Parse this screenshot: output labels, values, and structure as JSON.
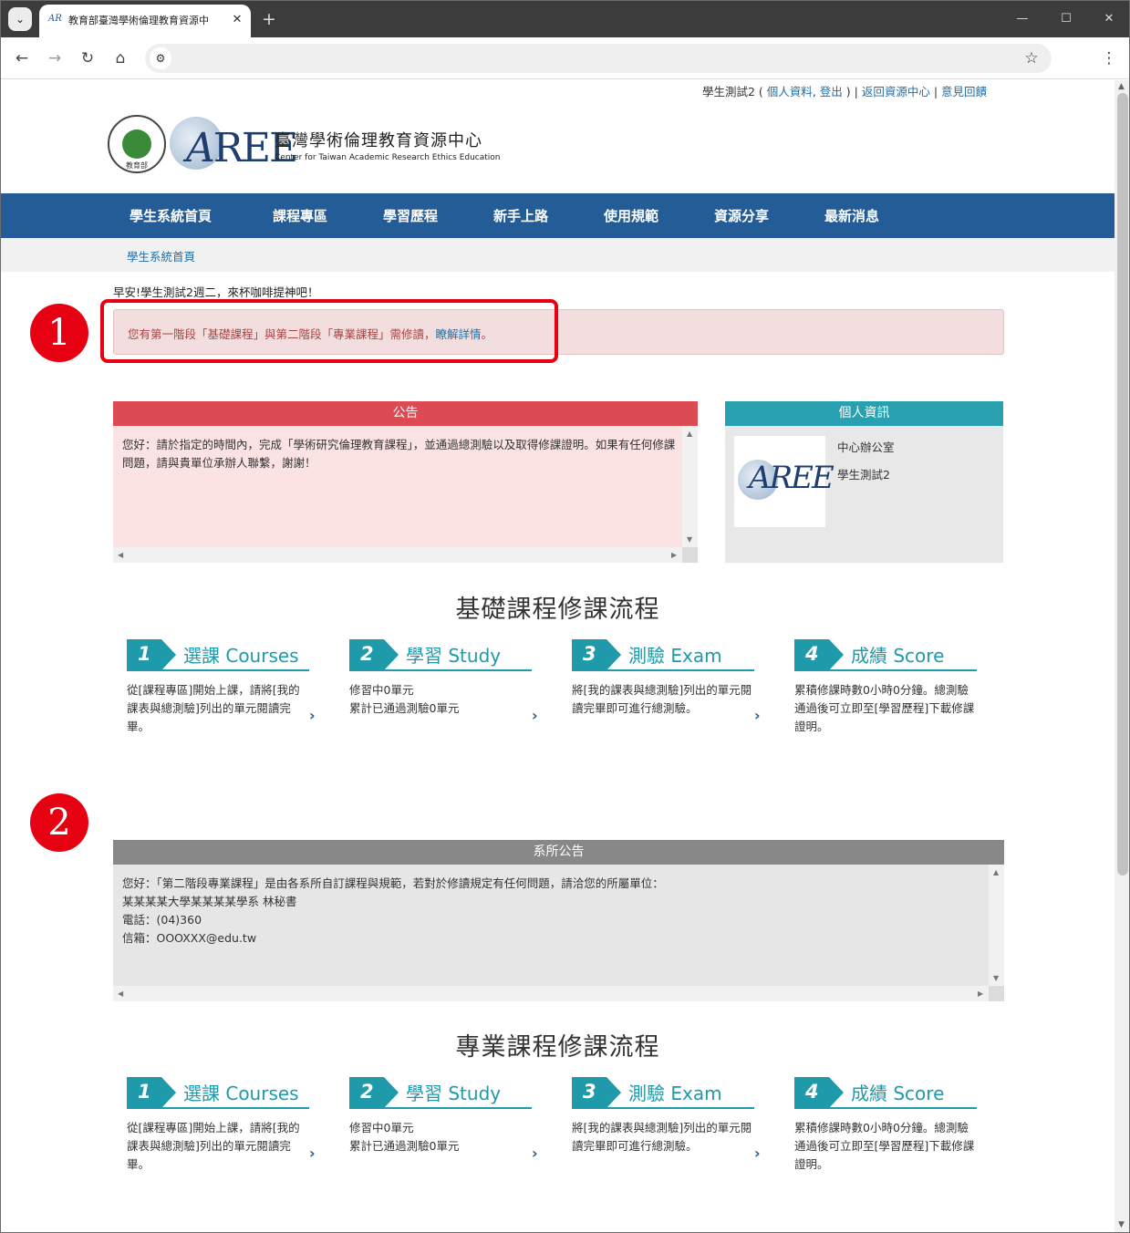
{
  "browser": {
    "tab_title": "教育部臺灣學術倫理教育資源中",
    "tab_favicon": "AR",
    "icons": {
      "search_tabs": "⌄",
      "close": "✕",
      "new_tab": "+",
      "minimize": "—",
      "maximize": "☐",
      "close_window": "✕",
      "back": "←",
      "forward": "→",
      "reload": "↻",
      "home": "⌂",
      "site_info": "⚙",
      "bookmark": "☆",
      "menu": "⋮"
    }
  },
  "header": {
    "user": "學生測試2 (",
    "profile_link": "個人資料",
    "comma": ",",
    "logout_link": "登出",
    "close_paren": ") |",
    "return_link": "返回資源中心",
    "sep": "|",
    "feedback_link": "意見回饋",
    "logo_seal_text": "教育部",
    "logo_mark_a": "A",
    "logo_mark_ree": "REE",
    "center_name_zh": "臺灣學術倫理教育資源中心",
    "center_name_en": "Center for Taiwan Academic Research Ethics Education"
  },
  "nav": {
    "items": [
      "學生系統首頁",
      "課程專區",
      "學習歷程",
      "新手上路",
      "使用規範",
      "資源分享",
      "最新消息"
    ]
  },
  "breadcrumb": "學生系統首頁",
  "greeting": "早安!學生測試2週二，來杯咖啡提神吧！",
  "alert": {
    "text": "您有第一階段「基礎課程」與第二階段「專業課程」需修讀，",
    "link": "瞭解詳情",
    "end": "。"
  },
  "annotations": {
    "one": "1",
    "two": "2",
    "color": "#e60012"
  },
  "announcement": {
    "title": "公告",
    "body": "您好：請於指定的時間內，完成「學術研究倫理教育課程」，並通過總測驗以及取得修課證明。如果有任何修課問題，請與貴單位承辦人聯繫，謝謝！"
  },
  "profile": {
    "title": "個人資訊",
    "org": "中心辦公室",
    "name": "學生測試2",
    "avatar_mark": "AREE"
  },
  "basic": {
    "title": "基礎課程修課流程",
    "steps": [
      {
        "num": "1",
        "title": "選課 Courses",
        "desc": "從[課程專區]開始上課，請將[我的課表與總測驗]列出的單元閱讀完畢。"
      },
      {
        "num": "2",
        "title": "學習 Study",
        "desc": "修習中0單元\n累計已通過測驗0單元"
      },
      {
        "num": "3",
        "title": "測驗 Exam",
        "desc": "將[我的課表與總測驗]列出的單元閱讀完畢即可進行總測驗。"
      },
      {
        "num": "4",
        "title": "成績 Score",
        "desc": "累積修課時數0小時0分鐘。總測驗通過後可立即至[學習歷程]下載修課證明。"
      }
    ]
  },
  "dept": {
    "title": "系所公告",
    "lines": [
      "您好：「第二階段專業課程」是由各系所自訂課程與規範，若對於修讀規定有任何問題，請洽您的所屬單位：",
      "某某某某大學某某某某學系 林秘書",
      "電話：(04)360",
      "信箱：OOOXXX@edu.tw"
    ]
  },
  "pro": {
    "title": "專業課程修課流程",
    "steps": [
      {
        "num": "1",
        "title": "選課 Courses",
        "desc": "從[課程專區]開始上課，請將[我的課表與總測驗]列出的單元閱讀完畢。"
      },
      {
        "num": "2",
        "title": "學習 Study",
        "desc": "修習中0單元\n累計已通過測驗0單元"
      },
      {
        "num": "3",
        "title": "測驗 Exam",
        "desc": "將[我的課表與總測驗]列出的單元閱讀完畢即可進行總測驗。"
      },
      {
        "num": "4",
        "title": "成績 Score",
        "desc": "累積修課時數0小時0分鐘。總測驗通過後可立即至[學習歷程]下載修課證明。"
      }
    ]
  },
  "colors": {
    "nav": "#235c96",
    "accent": "#1e9aab",
    "announce": "#dc4a53",
    "profile": "#28a0b0"
  }
}
